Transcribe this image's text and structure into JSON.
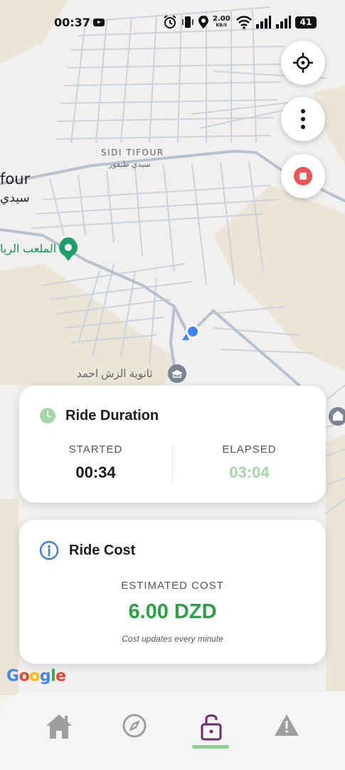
{
  "status_bar": {
    "time": "00:37",
    "network_speed_value": "2.00",
    "network_speed_unit": "KB/S",
    "battery": "41",
    "icons": [
      "youtube-icon",
      "alarm-icon",
      "vibrate-icon",
      "location-icon",
      "wifi-icon",
      "signal-icon",
      "signal-icon",
      "battery-icon"
    ]
  },
  "map": {
    "labels": {
      "town_latin": "SIDI TIFOUR",
      "town_arabic": "سيدي طيفور",
      "town_large_latin": "four",
      "town_large_arabic": "سيدي",
      "stadium": "الملعب الريا",
      "school": "ثانوية الزش احمد"
    },
    "attribution": "Google",
    "colors": {
      "land": "#f1f0ee",
      "roads": "#c9d3dd",
      "terrain": "#ebe5d6",
      "stadium_pin": "#1e9e6a",
      "user_location": "#4285f4"
    }
  },
  "controls": {
    "locate_icon": "crosshair-icon",
    "menu_icon": "more-vertical-icon",
    "stop_icon": "stop-icon"
  },
  "ride_duration": {
    "title": "Ride Duration",
    "icon": "clock-icon",
    "started_label": "STARTED",
    "started_value": "00:34",
    "elapsed_label": "ELAPSED",
    "elapsed_value": "03:04"
  },
  "ride_cost": {
    "title": "Ride Cost",
    "icon": "info-icon",
    "estimated_label": "ESTIMATED COST",
    "estimated_value": "6.00 DZD",
    "note": "Cost updates every minute"
  },
  "bottom_nav": {
    "items": [
      {
        "name": "home",
        "icon": "home-icon",
        "active": false
      },
      {
        "name": "explore",
        "icon": "compass-icon",
        "active": false
      },
      {
        "name": "unlock",
        "icon": "unlock-icon",
        "active": true
      },
      {
        "name": "report",
        "icon": "warning-icon",
        "active": false
      }
    ],
    "active_color": "#6a2c6e",
    "indicator_color": "#8fcf95"
  }
}
